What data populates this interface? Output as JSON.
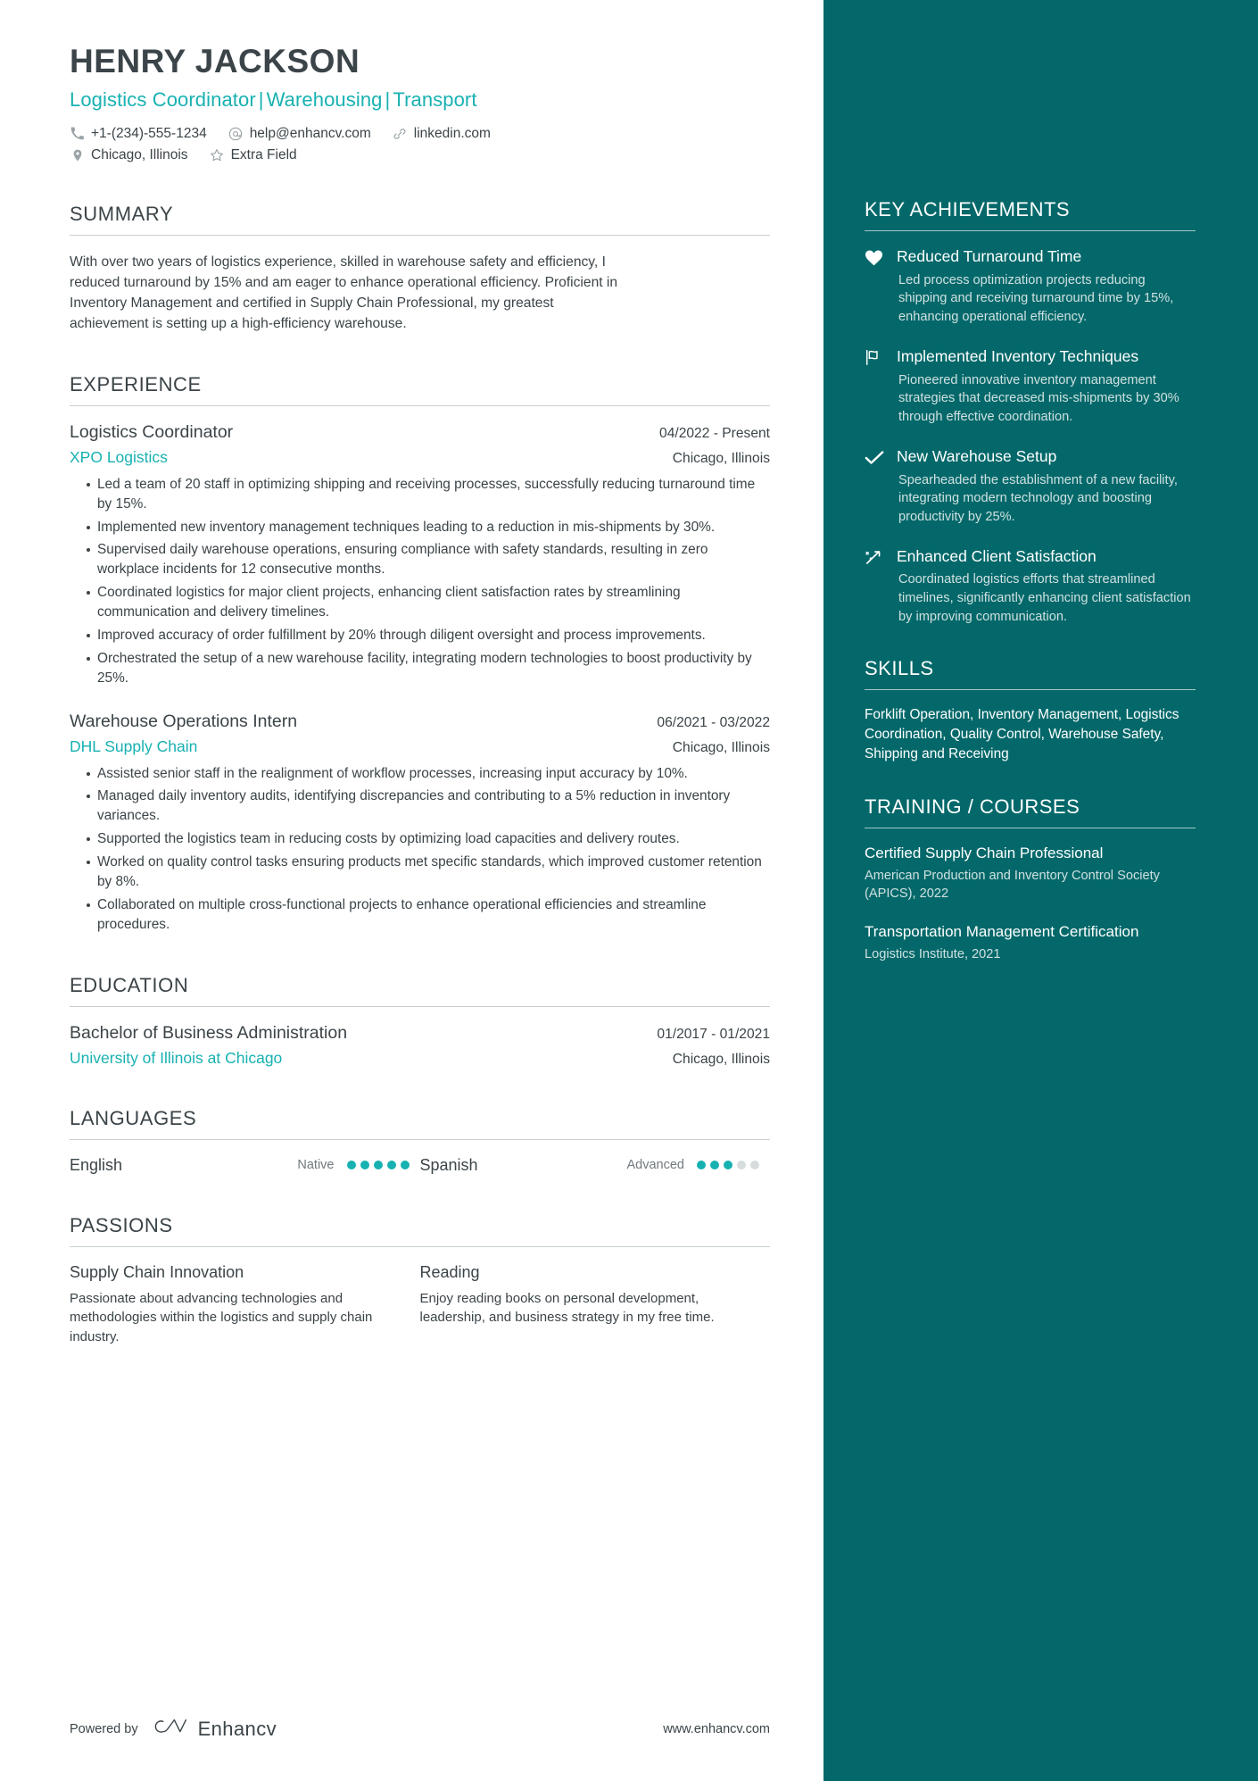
{
  "header": {
    "name": "HENRY JACKSON",
    "headline_parts": [
      "Logistics Coordinator",
      "Warehousing",
      "Transport"
    ],
    "separator": "|",
    "contacts_row1": [
      {
        "icon": "phone-icon",
        "text": "+1-(234)-555-1234"
      },
      {
        "icon": "email-icon",
        "text": "help@enhancv.com"
      },
      {
        "icon": "link-icon",
        "text": "linkedin.com"
      }
    ],
    "contacts_row2": [
      {
        "icon": "location-pin-icon",
        "text": "Chicago, Illinois"
      },
      {
        "icon": "star-icon",
        "text": "Extra Field"
      }
    ]
  },
  "summary": {
    "title": "SUMMARY",
    "text": "With over two years of logistics experience, skilled in warehouse safety and efficiency, I reduced turnaround by 15% and am eager to enhance operational efficiency. Proficient in Inventory Management and certified in Supply Chain Professional, my greatest achievement is setting up a high-efficiency warehouse."
  },
  "experience": {
    "title": "EXPERIENCE",
    "entries": [
      {
        "position": "Logistics Coordinator",
        "date": "04/2022 - Present",
        "company": "XPO Logistics",
        "location": "Chicago, Illinois",
        "bullets": [
          "Led a team of 20 staff in optimizing shipping and receiving processes, successfully reducing turnaround time by 15%.",
          "Implemented new inventory management techniques leading to a reduction in mis-shipments by 30%.",
          "Supervised daily warehouse operations, ensuring compliance with safety standards, resulting in zero workplace incidents for 12 consecutive months.",
          "Coordinated logistics for major client projects, enhancing client satisfaction rates by streamlining communication and delivery timelines.",
          "Improved accuracy of order fulfillment by 20% through diligent oversight and process improvements.",
          "Orchestrated the setup of a new warehouse facility, integrating modern technologies to boost productivity by 25%."
        ]
      },
      {
        "position": "Warehouse Operations Intern",
        "date": "06/2021 - 03/2022",
        "company": "DHL Supply Chain",
        "location": "Chicago, Illinois",
        "bullets": [
          "Assisted senior staff in the realignment of workflow processes, increasing input accuracy by 10%.",
          "Managed daily inventory audits, identifying discrepancies and contributing to a 5% reduction in inventory variances.",
          "Supported the logistics team in reducing costs by optimizing load capacities and delivery routes.",
          "Worked on quality control tasks ensuring products met specific standards, which improved customer retention by 8%.",
          "Collaborated on multiple cross-functional projects to enhance operational efficiencies and streamline procedures."
        ]
      }
    ]
  },
  "education": {
    "title": "EDUCATION",
    "entries": [
      {
        "degree": "Bachelor of Business Administration",
        "date": "01/2017 - 01/2021",
        "school": "University of Illinois at Chicago",
        "location": "Chicago, Illinois"
      }
    ]
  },
  "languages": {
    "title": "LANGUAGES",
    "items": [
      {
        "name": "English",
        "level": "Native",
        "filled": 5,
        "total": 5
      },
      {
        "name": "Spanish",
        "level": "Advanced",
        "filled": 3,
        "total": 5
      }
    ]
  },
  "passions": {
    "title": "PASSIONS",
    "items": [
      {
        "name": "Supply Chain Innovation",
        "description": "Passionate about advancing technologies and methodologies within the logistics and supply chain industry."
      },
      {
        "name": "Reading",
        "description": "Enjoy reading books on personal development, leadership, and business strategy in my free time."
      }
    ]
  },
  "footer": {
    "powered_by": "Powered by",
    "brand": "Enhancv",
    "url": "www.enhancv.com"
  },
  "sidebar": {
    "key_achievements": {
      "title": "KEY ACHIEVEMENTS",
      "items": [
        {
          "icon": "heart-icon",
          "title": "Reduced Turnaround Time",
          "description": "Led process optimization projects reducing shipping and receiving turnaround time by 15%, enhancing operational efficiency."
        },
        {
          "icon": "flag-icon",
          "title": "Implemented Inventory Techniques",
          "description": "Pioneered innovative inventory management strategies that decreased mis-shipments by 30% through effective coordination."
        },
        {
          "icon": "check-icon",
          "title": "New Warehouse Setup",
          "description": "Spearheaded the establishment of a new facility, integrating modern technology and boosting productivity by 25%."
        },
        {
          "icon": "rocket-trend-icon",
          "title": "Enhanced Client Satisfaction",
          "description": "Coordinated logistics efforts that streamlined timelines, significantly enhancing client satisfaction by improving communication."
        }
      ]
    },
    "skills": {
      "title": "SKILLS",
      "text": "Forklift Operation, Inventory Management, Logistics Coordination, Quality Control, Warehouse Safety, Shipping and Receiving"
    },
    "training": {
      "title": "TRAINING / COURSES",
      "items": [
        {
          "name": "Certified Supply Chain Professional",
          "detail": "American Production and Inventory Control Society (APICS), 2022"
        },
        {
          "name": "Transportation Management Certification",
          "detail": "Logistics Institute, 2021"
        }
      ]
    }
  },
  "colors": {
    "accent_teal": "#18b1b1",
    "sidebar_bg": "#04686a",
    "text_dark": "#3b4448"
  }
}
